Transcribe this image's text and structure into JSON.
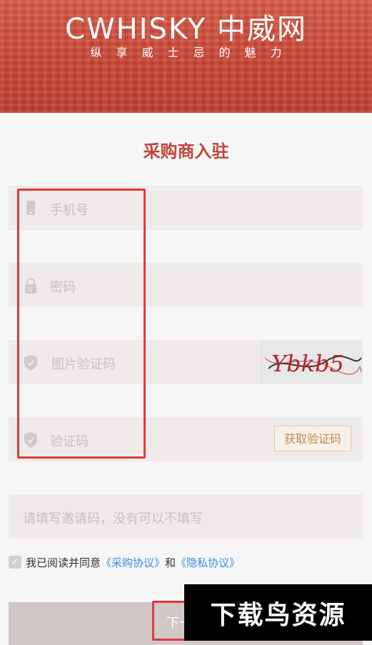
{
  "header": {
    "brand": "CWHISKY 中威网",
    "tagline": "纵享威士忌的魅力"
  },
  "page": {
    "title": "采购商入驻"
  },
  "form": {
    "phone_placeholder": "手机号",
    "password_placeholder": "密码",
    "captcha_placeholder": "图片验证码",
    "captcha_text": "Ybkb5",
    "sms_placeholder": "验证码",
    "send_code_label": "获取验证码",
    "invite_placeholder": "请填写邀请码，没有可以不填写"
  },
  "agreement": {
    "prefix": "我已阅读并同意",
    "purchase_link": "《采购协议》",
    "and": "和",
    "privacy_link": "《隐私协议》",
    "checked": true
  },
  "next_button": {
    "label": "下一步"
  },
  "watermark": {
    "text": "下载鸟资源"
  },
  "colors": {
    "brand_red": "#c84534",
    "title_red": "#c0453c",
    "link_blue": "#3a8ee6",
    "annotation_red": "#e03a3a"
  }
}
